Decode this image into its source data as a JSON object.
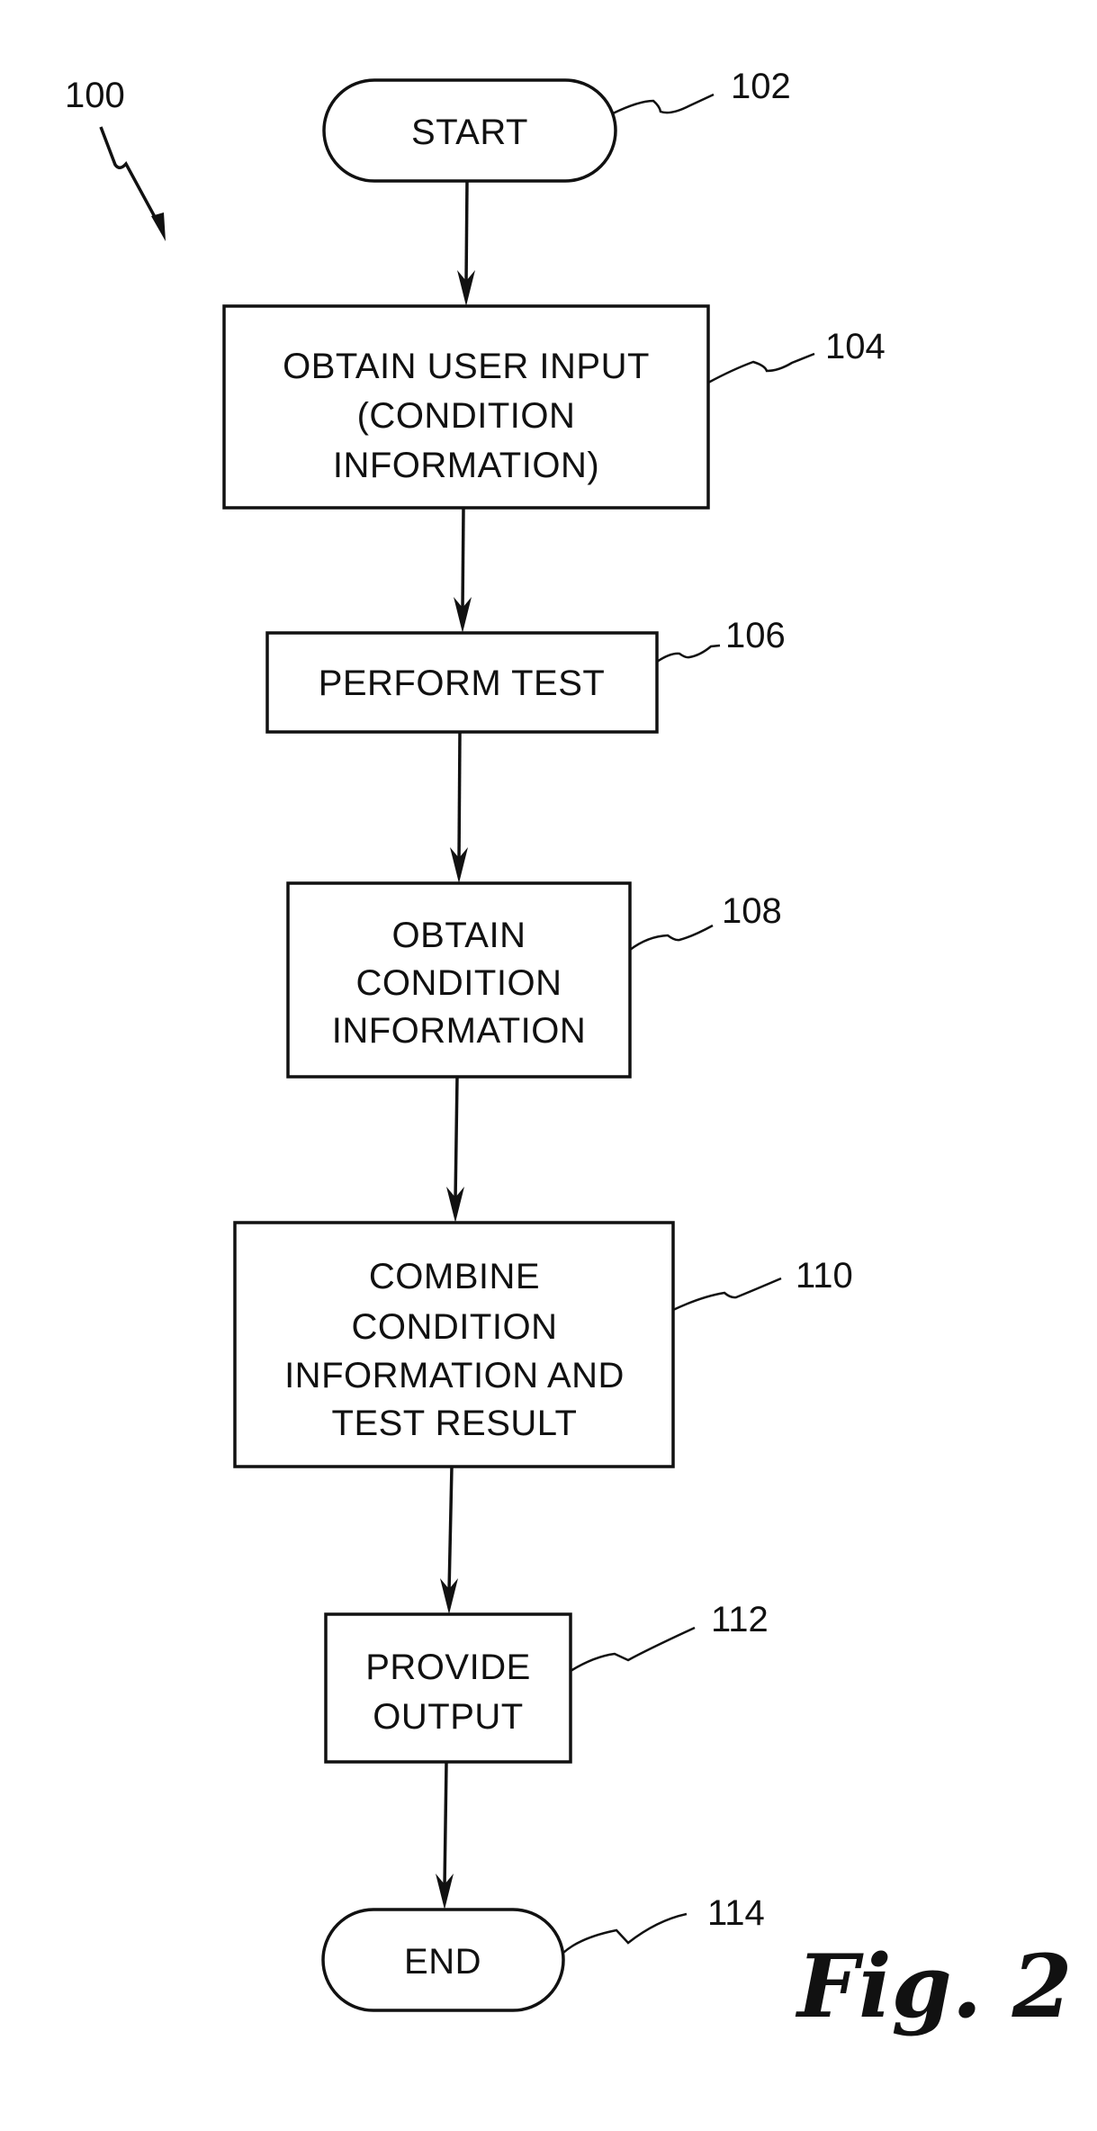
{
  "figure": {
    "diagram_ref": "100",
    "caption": "Fig. 2"
  },
  "nodes": [
    {
      "id": "start",
      "ref": "102",
      "shape": "terminal",
      "lines": [
        "START"
      ]
    },
    {
      "id": "obtain-user-input",
      "ref": "104",
      "shape": "process",
      "lines": [
        "OBTAIN USER INPUT",
        "(CONDITION",
        "INFORMATION)"
      ]
    },
    {
      "id": "perform-test",
      "ref": "106",
      "shape": "process",
      "lines": [
        "PERFORM TEST"
      ]
    },
    {
      "id": "obtain-condition-information",
      "ref": "108",
      "shape": "process",
      "lines": [
        "OBTAIN",
        "CONDITION",
        "INFORMATION"
      ]
    },
    {
      "id": "combine",
      "ref": "110",
      "shape": "process",
      "lines": [
        "COMBINE",
        "CONDITION",
        "INFORMATION AND",
        "TEST RESULT"
      ]
    },
    {
      "id": "provide-output",
      "ref": "112",
      "shape": "process",
      "lines": [
        "PROVIDE",
        "OUTPUT"
      ]
    },
    {
      "id": "end",
      "ref": "114",
      "shape": "terminal",
      "lines": [
        "END"
      ]
    }
  ],
  "edges": [
    {
      "from": "start",
      "to": "obtain-user-input"
    },
    {
      "from": "obtain-user-input",
      "to": "perform-test"
    },
    {
      "from": "perform-test",
      "to": "obtain-condition-information"
    },
    {
      "from": "obtain-condition-information",
      "to": "combine"
    },
    {
      "from": "combine",
      "to": "provide-output"
    },
    {
      "from": "provide-output",
      "to": "end"
    }
  ],
  "colors": {
    "ink": "#111111",
    "paper": "#ffffff"
  }
}
